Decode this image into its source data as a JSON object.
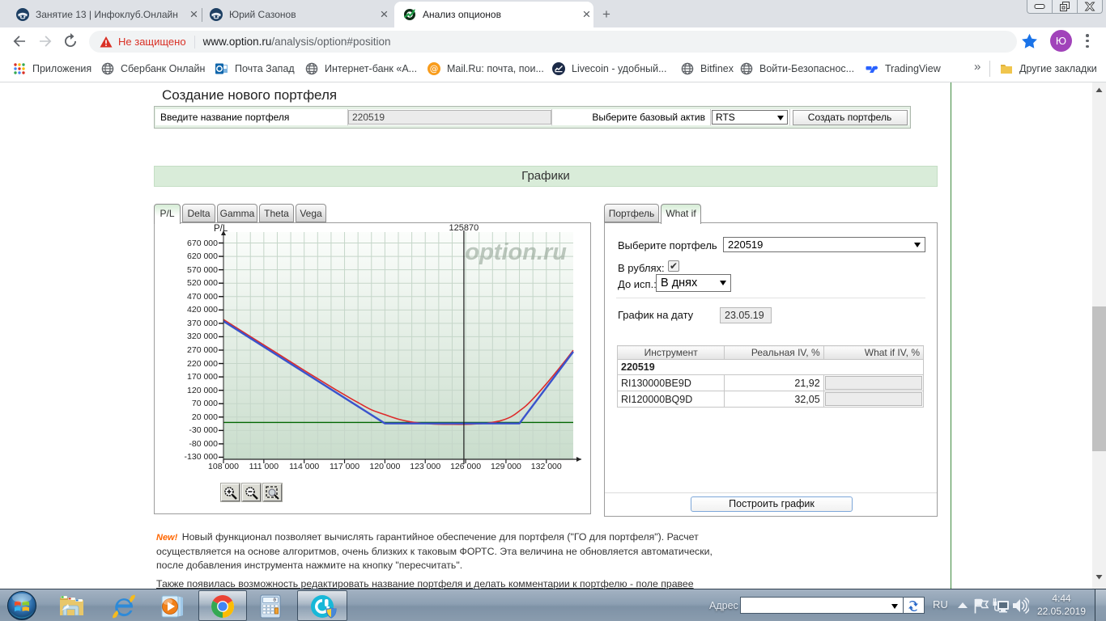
{
  "browser": {
    "tabs": [
      {
        "title": "Занятие 13 | Инфоклуб.Онлайн",
        "favicon": "infoclub-icon",
        "active": false
      },
      {
        "title": "Юрий Сазонов",
        "favicon": "infoclub-icon",
        "active": false
      },
      {
        "title": "Анализ опционов",
        "favicon": "optionru-icon",
        "active": true
      }
    ],
    "window_controls": [
      "minimize-icon",
      "restore-icon",
      "close-icon"
    ],
    "toolbar": {
      "security_warning": "Не защищено",
      "url_domain": "www.option.ru",
      "url_path": "/analysis/option#position",
      "avatar_initial": "Ю"
    },
    "bookmarks": {
      "items": [
        {
          "label": "Приложения",
          "icon": "apps-grid-icon"
        },
        {
          "label": "Сбербанк Онлайн",
          "icon": "globe-icon"
        },
        {
          "label": "Почта Запад",
          "icon": "outlook-icon"
        },
        {
          "label": "Интернет-банк «А...",
          "icon": "globe-icon"
        },
        {
          "label": "Mail.Ru: почта, пои...",
          "icon": "mailru-icon"
        },
        {
          "label": "Livecoin - удобный...",
          "icon": "livecoin-icon"
        },
        {
          "label": "Bitfinex",
          "icon": "globe-icon"
        },
        {
          "label": "Войти-Безопаснос...",
          "icon": "globe-icon"
        },
        {
          "label": "TradingView",
          "icon": "tradingview-icon"
        }
      ],
      "overflow_chevron": "»",
      "other_bookmarks_label": "Другие закладки"
    }
  },
  "page": {
    "heading": "Создание нового портфеля",
    "portfolio_form": {
      "name_label": "Введите название портфеля",
      "name_value": "220519",
      "asset_label": "Выберите базовый актив",
      "asset_value": "RTS",
      "create_button": "Создать портфель"
    },
    "charts_banner": "Графики",
    "chart_tabs": [
      {
        "label": "P/L",
        "active": true
      },
      {
        "label": "Delta",
        "active": false
      },
      {
        "label": "Gamma",
        "active": false
      },
      {
        "label": "Theta",
        "active": false
      },
      {
        "label": "Vega",
        "active": false
      }
    ],
    "right_tabs": [
      {
        "label": "Портфель",
        "active": false
      },
      {
        "label": "What if",
        "active": true
      }
    ],
    "whatif": {
      "select_label": "Выберите портфель",
      "select_value": "220519",
      "rubles_label": "В рублях:",
      "rubles_checked": "✔",
      "until_label": "До исп.:",
      "until_value": "В днях",
      "date_label": "График на дату",
      "date_value": "23.05.19",
      "table": {
        "headers": [
          "Инструмент",
          "Реальная IV, %",
          "What if IV, %"
        ],
        "group_row": "220519",
        "rows": [
          {
            "name": "RI130000BE9D",
            "real_iv": "21,92",
            "whatif_iv": ""
          },
          {
            "name": "RI120000BQ9D",
            "real_iv": "32,05",
            "whatif_iv": ""
          }
        ]
      },
      "build_button": "Построить график"
    },
    "news": {
      "badge": "New!",
      "lines": [
        " Новый функционал позволяет вычислять гарантийное обеспечение для портфеля (\"ГО для портфеля\"). Расчет",
        "осуществляется на основе алгоритмов, очень близких к таковым ФОРТС. Эта величина не обновляется автоматически,",
        "после добавления инструмента нажмите на кнопку \"пересчитать\"."
      ],
      "para2": "Также появилась возможность редактировать название портфеля и делать комментарии к портфелю - поле правее"
    }
  },
  "chart_data": {
    "type": "line",
    "ylabel": "P/L",
    "watermark": "option.ru",
    "crosshair_x": 125870,
    "crosshair_label": "125870",
    "x_range": [
      108000,
      134000
    ],
    "y_top_value": 710800,
    "x_ticks": [
      108000,
      111000,
      114000,
      117000,
      120000,
      123000,
      126000,
      129000,
      132000
    ],
    "x_tick_labels": [
      "108 000",
      "111 000",
      "114 000",
      "117 000",
      "120 000",
      "123 000",
      "126 000",
      "129 000",
      "132 000"
    ],
    "y_ticks": [
      670000,
      620000,
      570000,
      520000,
      470000,
      420000,
      370000,
      320000,
      270000,
      220000,
      170000,
      120000,
      70000,
      20000,
      -30000,
      -80000,
      -130000
    ],
    "y_tick_labels": [
      "670 000",
      "620 000",
      "570 000",
      "520 000",
      "470 000",
      "420 000",
      "370 000",
      "320 000",
      "270 000",
      "220 000",
      "170 000",
      "120 000",
      "70 000",
      "20 000",
      "-30 000",
      "-80 000",
      "-130 000"
    ],
    "grid_step_x": 1000,
    "grid_step_y": 50000,
    "zero_line": {
      "y": 0,
      "color": "#006600"
    },
    "series": [
      {
        "name": "expiration",
        "color": "#3a53cc",
        "width": 2.4,
        "points": [
          [
            108000,
            378000
          ],
          [
            120000,
            -4000
          ],
          [
            130000,
            -4000
          ],
          [
            134000,
            264000
          ]
        ]
      },
      {
        "name": "current",
        "color": "#dd2b2b",
        "width": 1.6,
        "smooth": true,
        "points": [
          [
            108000,
            384000
          ],
          [
            110000,
            320600
          ],
          [
            112000,
            257500
          ],
          [
            114000,
            194500
          ],
          [
            116000,
            132800
          ],
          [
            117000,
            103000
          ],
          [
            118000,
            74200
          ],
          [
            119000,
            47300
          ],
          [
            120000,
            29000
          ],
          [
            121000,
            12000
          ],
          [
            122000,
            1500
          ],
          [
            123000,
            -4000
          ],
          [
            124000,
            -6500
          ],
          [
            125000,
            -7000
          ],
          [
            126000,
            -7000
          ],
          [
            126800,
            -5500
          ],
          [
            127500,
            -3000
          ],
          [
            128000,
            500
          ],
          [
            128600,
            6500
          ],
          [
            129200,
            17000
          ],
          [
            129600,
            28000
          ],
          [
            130000,
            43000
          ],
          [
            130500,
            62500
          ],
          [
            131200,
            98400
          ],
          [
            132000,
            144000
          ],
          [
            132800,
            192600
          ],
          [
            133500,
            236500
          ],
          [
            134000,
            269000
          ]
        ]
      }
    ]
  },
  "taskbar": {
    "start": "start-orb",
    "apps": [
      {
        "icon": "explorer-icon"
      },
      {
        "icon": "ie-icon"
      },
      {
        "icon": "wmp-icon"
      },
      {
        "icon": "chrome-icon",
        "open": true
      },
      {
        "icon": "calculator-icon"
      },
      {
        "icon": "recorder-icon",
        "open": true
      }
    ],
    "address_label": "Адрес",
    "language": "RU",
    "tray_icons": [
      "hidden-icons-chevron",
      "action-center-flag-icon",
      "network-icon",
      "volume-icon"
    ],
    "clock_time": "4:44",
    "clock_date": "22.05.2019"
  }
}
